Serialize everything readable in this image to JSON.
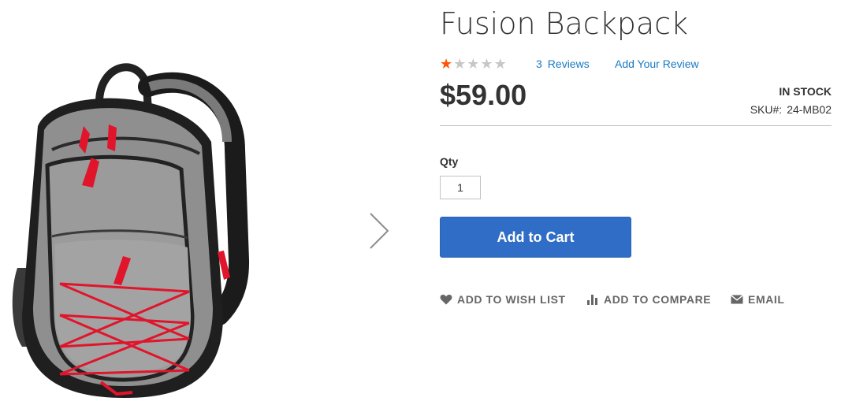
{
  "product": {
    "title": "Fusion Backpack",
    "rating": {
      "stars_filled": 1,
      "stars_total": 5
    },
    "reviews_count": "3",
    "reviews_label": "Reviews",
    "add_review_label": "Add Your Review",
    "price": "$59.00",
    "stock_status": "In stock",
    "sku_label": "SKU#:",
    "sku_value": "24-MB02"
  },
  "form": {
    "qty_label": "Qty",
    "qty_value": "1",
    "add_to_cart_label": "Add to Cart"
  },
  "actions": {
    "wishlist_label": "Add to Wish List",
    "compare_label": "Add to Compare",
    "email_label": "Email"
  },
  "icons": {
    "gallery_next": "chevron-right-icon",
    "wishlist": "heart-icon",
    "compare": "bar-chart-icon",
    "email": "envelope-icon",
    "star": "star-icon"
  },
  "colors": {
    "accent_button": "#2f6dc6",
    "link": "#1979c3",
    "star_on": "#ff5501",
    "star_off": "#c7c7c7",
    "backpack_body": "#8f8f8f",
    "backpack_accent": "#e0152b"
  }
}
